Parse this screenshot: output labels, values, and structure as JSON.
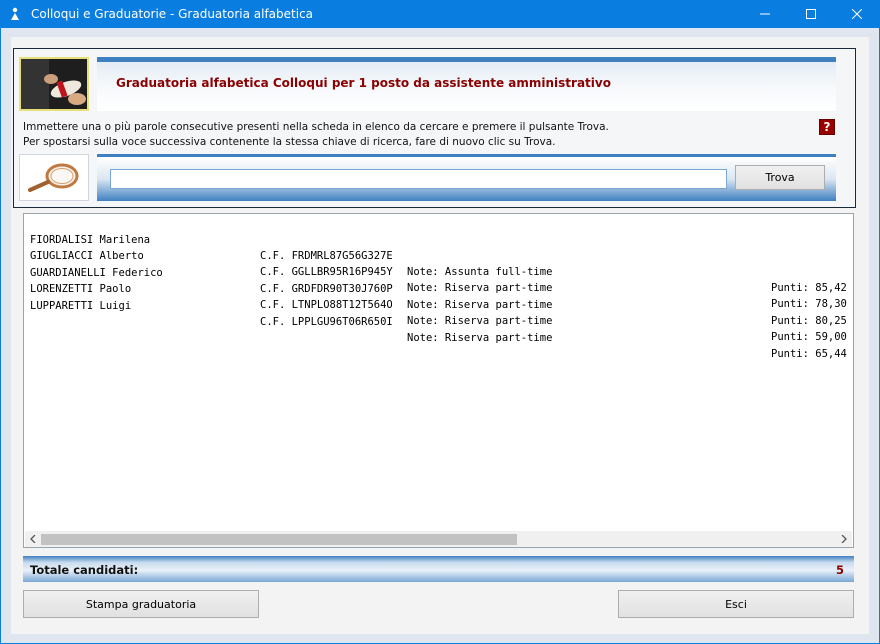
{
  "window": {
    "title": "Colloqui e Graduatorie - Graduatoria alfabetica",
    "app_icon": "app-icon",
    "controls": {
      "minimize": "—",
      "maximize": "☐",
      "close": "✕"
    }
  },
  "header": {
    "title": "Graduatoria alfabetica Colloqui per 1 posto da assistente amministrativo",
    "instructions": [
      "Immettere una o più parole consecutive presenti nella scheda in elenco da cercare e premere il pulsante Trova.",
      "Per spostarsi sulla voce successiva contenente la stessa chiave di ricerca, fare di nuovo clic su Trova."
    ],
    "help_label": "?"
  },
  "search": {
    "value": "",
    "button_label": "Trova"
  },
  "list": {
    "rows": [
      {
        "name": "FIORDALISI Marilena",
        "cf": "C.F. FRDMRL87G56G327E",
        "note": "Note: Assunta full-time",
        "punti": "Punti: 85,42"
      },
      {
        "name": "GIUGLIACCI Alberto",
        "cf": "C.F. GGLLBR95R16P945Y",
        "note": "Note: Riserva part-time",
        "punti": "Punti: 78,30"
      },
      {
        "name": "GUARDIANELLI Federico",
        "cf": "C.F. GRDFDR90T30J760P",
        "note": "Note: Riserva part-time",
        "punti": "Punti: 80,25"
      },
      {
        "name": "LORENZETTI Paolo",
        "cf": "C.F. LTNPLO88T12T564O",
        "note": "Note: Riserva part-time",
        "punti": "Punti: 59,00"
      },
      {
        "name": "LUPPARETTI Luigi",
        "cf": "C.F. LPPLGU96T06R650I",
        "note": "Note: Riserva part-time",
        "punti": "Punti: 65,44"
      }
    ]
  },
  "totals": {
    "label": "Totale candidati:",
    "value": "5"
  },
  "footer": {
    "print_label": "Stampa graduatoria",
    "exit_label": "Esci"
  },
  "colors": {
    "titlebar": "#0a7ee0",
    "accent": "#3f80c0",
    "title_red": "#8b0000"
  }
}
